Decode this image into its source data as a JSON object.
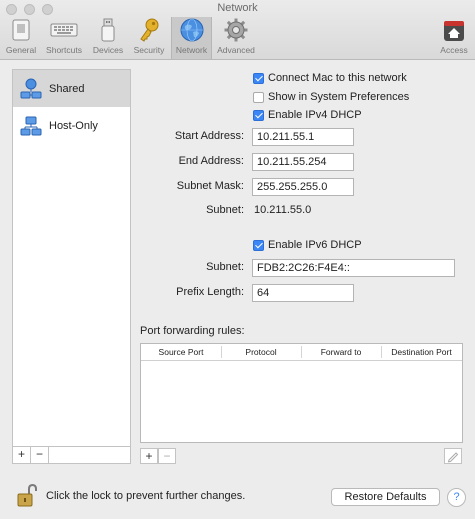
{
  "window": {
    "title": "Network"
  },
  "toolbar": {
    "items": [
      {
        "label": "General"
      },
      {
        "label": "Shortcuts"
      },
      {
        "label": "Devices"
      },
      {
        "label": "Security"
      },
      {
        "label": "Network"
      },
      {
        "label": "Advanced"
      },
      {
        "label": "Access"
      }
    ]
  },
  "sidebar": {
    "items": [
      {
        "label": "Shared",
        "selected": true
      },
      {
        "label": "Host-Only",
        "selected": false
      }
    ],
    "add_label": "+",
    "remove_label": "−"
  },
  "form": {
    "connect_mac": {
      "label": "Connect Mac to this network",
      "checked": true
    },
    "show_in_prefs": {
      "label": "Show in System Preferences",
      "checked": false
    },
    "enable_ipv4_dhcp": {
      "label": "Enable IPv4 DHCP",
      "checked": true
    },
    "start_address": {
      "label": "Start Address:",
      "value": "10.211.55.1"
    },
    "end_address": {
      "label": "End Address:",
      "value": "10.211.55.254"
    },
    "subnet_mask": {
      "label": "Subnet Mask:",
      "value": "255.255.255.0"
    },
    "subnet_v4": {
      "label": "Subnet:",
      "value": "10.211.55.0"
    },
    "enable_ipv6_dhcp": {
      "label": "Enable IPv6 DHCP",
      "checked": true
    },
    "subnet_v6": {
      "label": "Subnet:",
      "value": "FDB2:2C26:F4E4::"
    },
    "prefix_length": {
      "label": "Prefix Length:",
      "value": "64"
    }
  },
  "port_forwarding": {
    "title": "Port forwarding rules:",
    "columns": [
      "Source Port",
      "Protocol",
      "Forward to",
      "Destination Port"
    ],
    "rows": [],
    "add_label": "+",
    "remove_label": "−"
  },
  "footer": {
    "lock_text": "Click the lock to prevent further changes.",
    "restore_label": "Restore Defaults",
    "help_label": "?"
  },
  "colors": {
    "accent": "#3b86f6",
    "window_bg": "#ececec"
  }
}
